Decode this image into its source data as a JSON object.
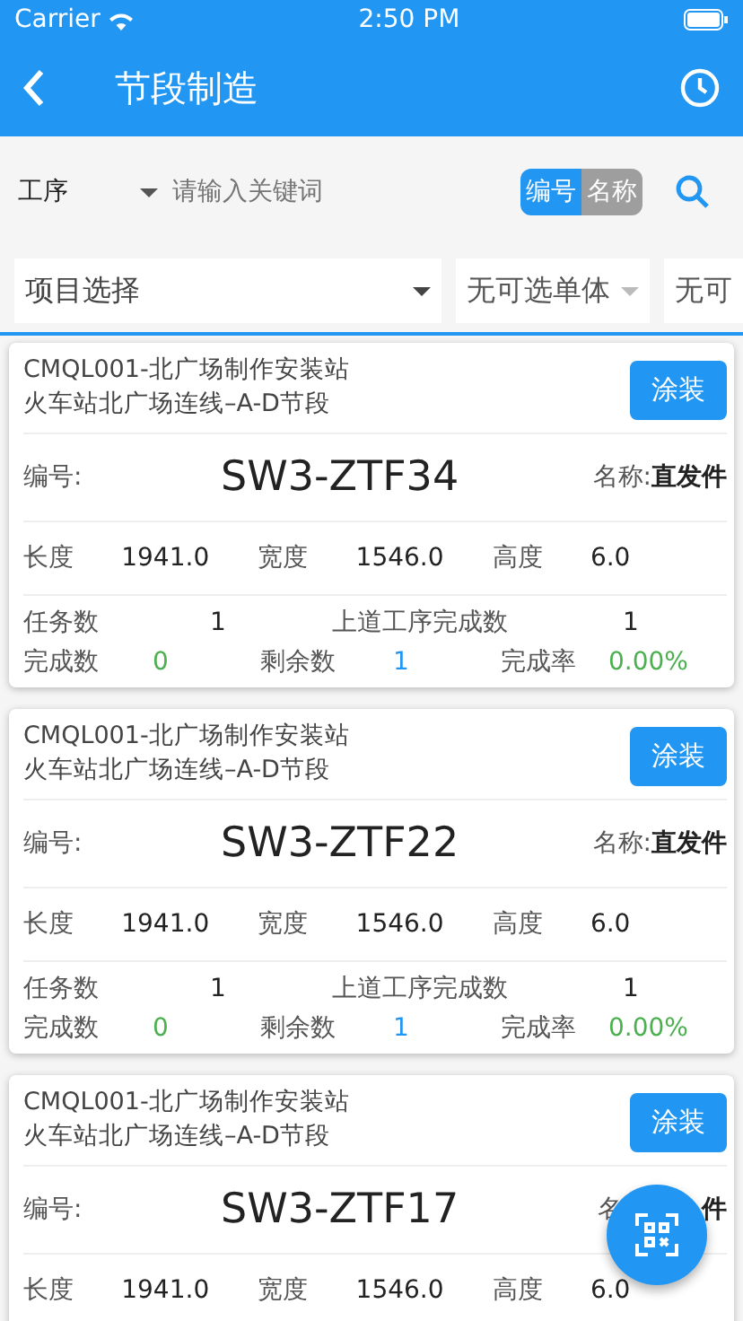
{
  "status_bar": {
    "carrier": "Carrier",
    "time": "2:50 PM"
  },
  "app_bar": {
    "title": "节段制造"
  },
  "filter": {
    "process": "工序",
    "placeholder": "请输入关键词",
    "modes": [
      {
        "label": "编号",
        "selected": true
      },
      {
        "label": "名称",
        "selected": false
      }
    ]
  },
  "dropdowns": [
    {
      "label": "项目选择",
      "disabled": false
    },
    {
      "label": "无可选单体",
      "disabled": true
    },
    {
      "label": "无可",
      "disabled": true
    }
  ],
  "cards": [
    {
      "project": "CMQL001-北广场制作安装站",
      "section": "火车站北广场连线–A-D节段",
      "action": "涂装",
      "code_label": "编号:",
      "code": "SW3-ZTF34",
      "name_label": "名称:",
      "name": "直发件",
      "dims": [
        {
          "label": "长度",
          "value": "1941.0"
        },
        {
          "label": "宽度",
          "value": "1546.0"
        },
        {
          "label": "高度",
          "value": "6.0"
        }
      ],
      "tasks": [
        {
          "label": "任务数",
          "value": "1"
        },
        {
          "label": "上道工序完成数",
          "value": "1"
        }
      ],
      "progress": [
        {
          "label": "完成数",
          "value": "0",
          "color": "#4caf50"
        },
        {
          "label": "剩余数",
          "value": "1",
          "color": "#2196f3"
        },
        {
          "label": "完成率",
          "value": "0.00%",
          "color": "#4caf50"
        }
      ]
    },
    {
      "project": "CMQL001-北广场制作安装站",
      "section": "火车站北广场连线–A-D节段",
      "action": "涂装",
      "code_label": "编号:",
      "code": "SW3-ZTF22",
      "name_label": "名称:",
      "name": "直发件",
      "dims": [
        {
          "label": "长度",
          "value": "1941.0"
        },
        {
          "label": "宽度",
          "value": "1546.0"
        },
        {
          "label": "高度",
          "value": "6.0"
        }
      ],
      "tasks": [
        {
          "label": "任务数",
          "value": "1"
        },
        {
          "label": "上道工序完成数",
          "value": "1"
        }
      ],
      "progress": [
        {
          "label": "完成数",
          "value": "0",
          "color": "#4caf50"
        },
        {
          "label": "剩余数",
          "value": "1",
          "color": "#2196f3"
        },
        {
          "label": "完成率",
          "value": "0.00%",
          "color": "#4caf50"
        }
      ]
    },
    {
      "project": "CMQL001-北广场制作安装站",
      "section": "火车站北广场连线–A-D节段",
      "action": "涂装",
      "code_label": "编号:",
      "code": "SW3-ZTF17",
      "name_label": "名",
      "name": "件",
      "dims": [
        {
          "label": "长度",
          "value": "1941.0"
        },
        {
          "label": "宽度",
          "value": "1546.0"
        },
        {
          "label": "高度",
          "value": "6.0"
        }
      ]
    }
  ]
}
